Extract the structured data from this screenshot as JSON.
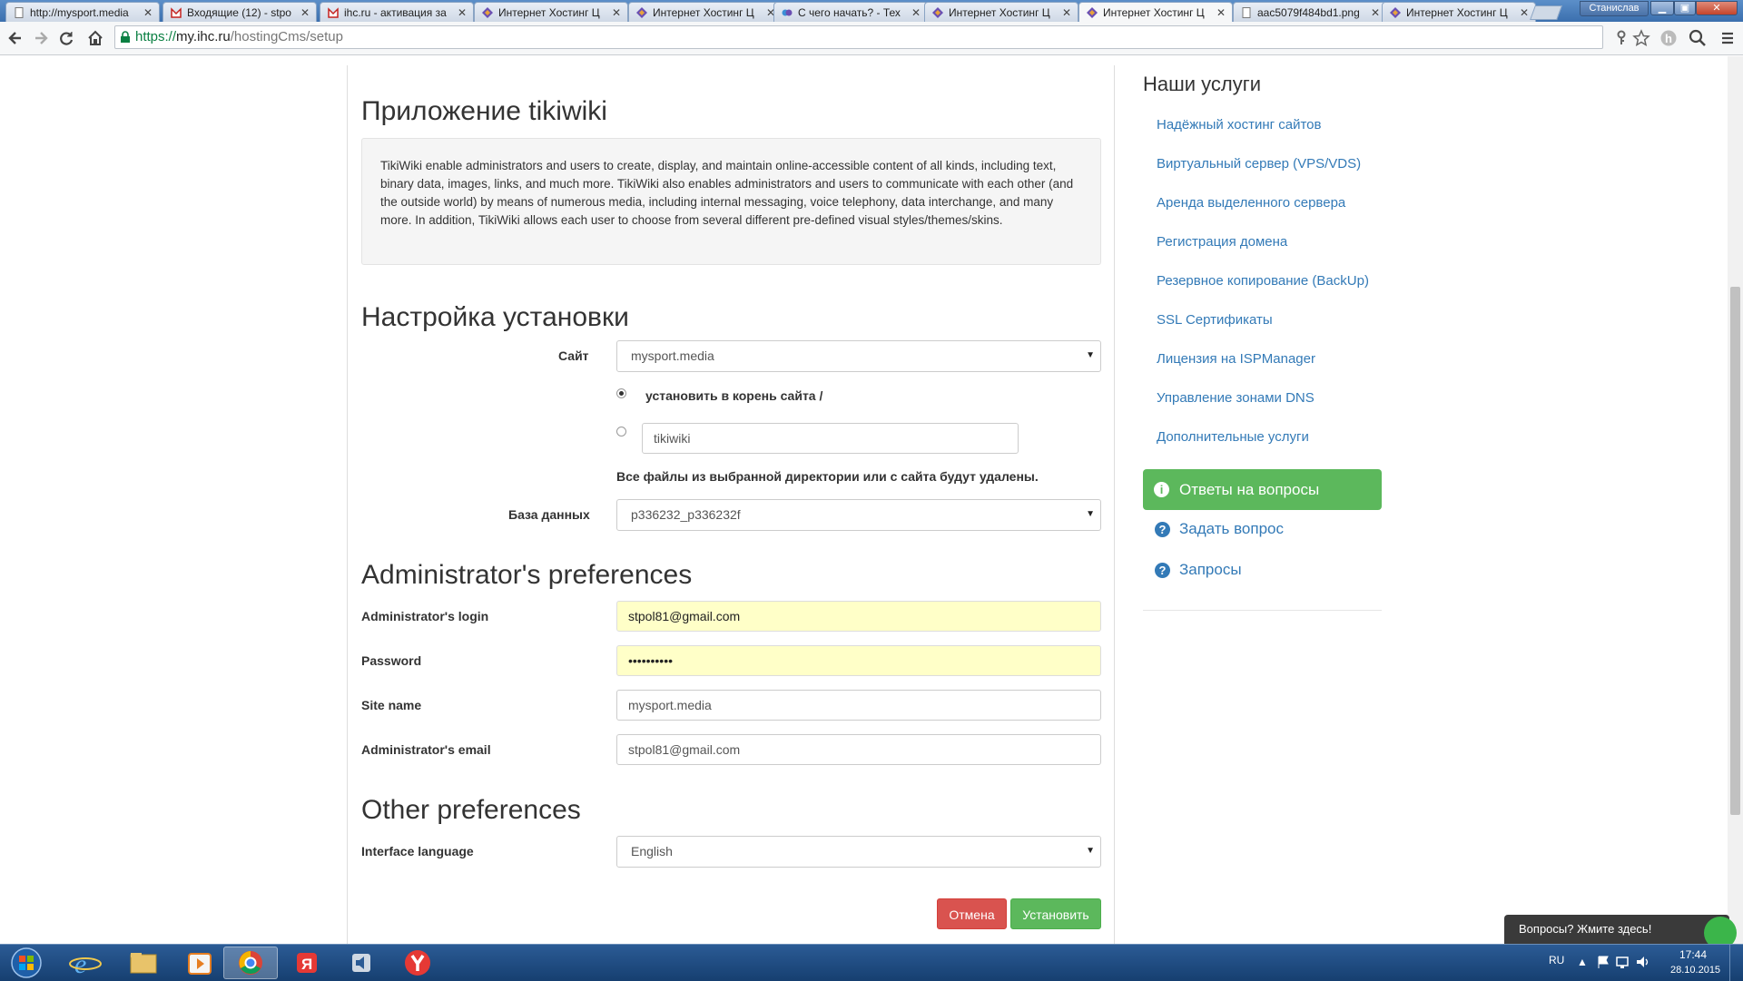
{
  "browser": {
    "tabs": [
      {
        "title": "http://mysport.media",
        "icon": "page-icon"
      },
      {
        "title": "Входящие (12) - stpo",
        "icon": "gmail-icon"
      },
      {
        "title": "ihc.ru - активация за",
        "icon": "gmail-icon"
      },
      {
        "title": "Интернет Хостинг Ц",
        "icon": "ihc-icon"
      },
      {
        "title": "Интернет Хостинг Ц",
        "icon": "ihc-icon"
      },
      {
        "title": "С чего начать? - Тех",
        "icon": "ihc-icon"
      },
      {
        "title": "Интернет Хостинг Ц",
        "icon": "ihc-icon"
      },
      {
        "title": "Интернет Хостинг Ц",
        "icon": "ihc-icon",
        "active": true
      },
      {
        "title": "aac5079f484bd1.png",
        "icon": "page-icon"
      },
      {
        "title": "Интернет Хостинг Ц",
        "icon": "ihc-icon"
      }
    ],
    "user": "Станислав",
    "url": {
      "scheme": "https://",
      "host": "my.ihc.ru",
      "path": "/hostingCms/setup"
    }
  },
  "app": {
    "heading": "Приложение tikiwiki",
    "description": "TikiWiki enable administrators and users to create, display, and maintain online-accessible content of all kinds, including text, binary data, images, links, and much more. TikiWiki also enables administrators and users to communicate with each other (and the outside world) by means of numerous media, including internal messaging, voice telephony, data interchange, and many more. In addition, TikiWiki allows each user to choose from several different pre-defined visual styles/themes/skins."
  },
  "install": {
    "heading": "Настройка установки",
    "site_label": "Сайт",
    "site_value": "mysport.media",
    "radio_root_label": "установить в корень сайта /",
    "radio_root_checked": true,
    "dir_value": "tikiwiki",
    "warning": "Все файлы из выбранной директории или с сайта будут удалены.",
    "db_label": "База данных",
    "db_value": "p336232_p336232f"
  },
  "admin": {
    "heading": "Administrator's preferences",
    "login_label": "Administrator's login",
    "login_value": "stpol81@gmail.com",
    "password_label": "Password",
    "password_value": "••••••••••",
    "site_name_label": "Site name",
    "site_name_value": "mysport.media",
    "email_label": "Administrator's email",
    "email_value": "stpol81@gmail.com"
  },
  "other": {
    "heading": "Other preferences",
    "lang_label": "Interface language",
    "lang_value": "English"
  },
  "buttons": {
    "cancel": "Отмена",
    "install": "Установить"
  },
  "sidebar": {
    "title": "Наши услуги",
    "links": [
      "Надёжный хостинг сайтов",
      "Виртуальный сервер (VPS/VDS)",
      "Аренда выделенного сервера",
      "Регистрация домена",
      "Резервное копирование (BackUp)",
      "SSL Сертификаты",
      "Лицензия на ISPManager",
      "Управление зонами DNS",
      "Дополнительные услуги"
    ],
    "faq_button": "Ответы на вопросы",
    "ask_link": "Задать вопрос",
    "requests_link": "Запросы"
  },
  "chat": {
    "label": "Вопросы? Жмите здесь!"
  },
  "taskbar": {
    "lang": "RU",
    "time": "17:44",
    "date": "28.10.2015"
  },
  "colors": {
    "link": "#337ab7",
    "success": "#5cb85c",
    "danger": "#d9534f",
    "autofill": "#ffffc8"
  }
}
